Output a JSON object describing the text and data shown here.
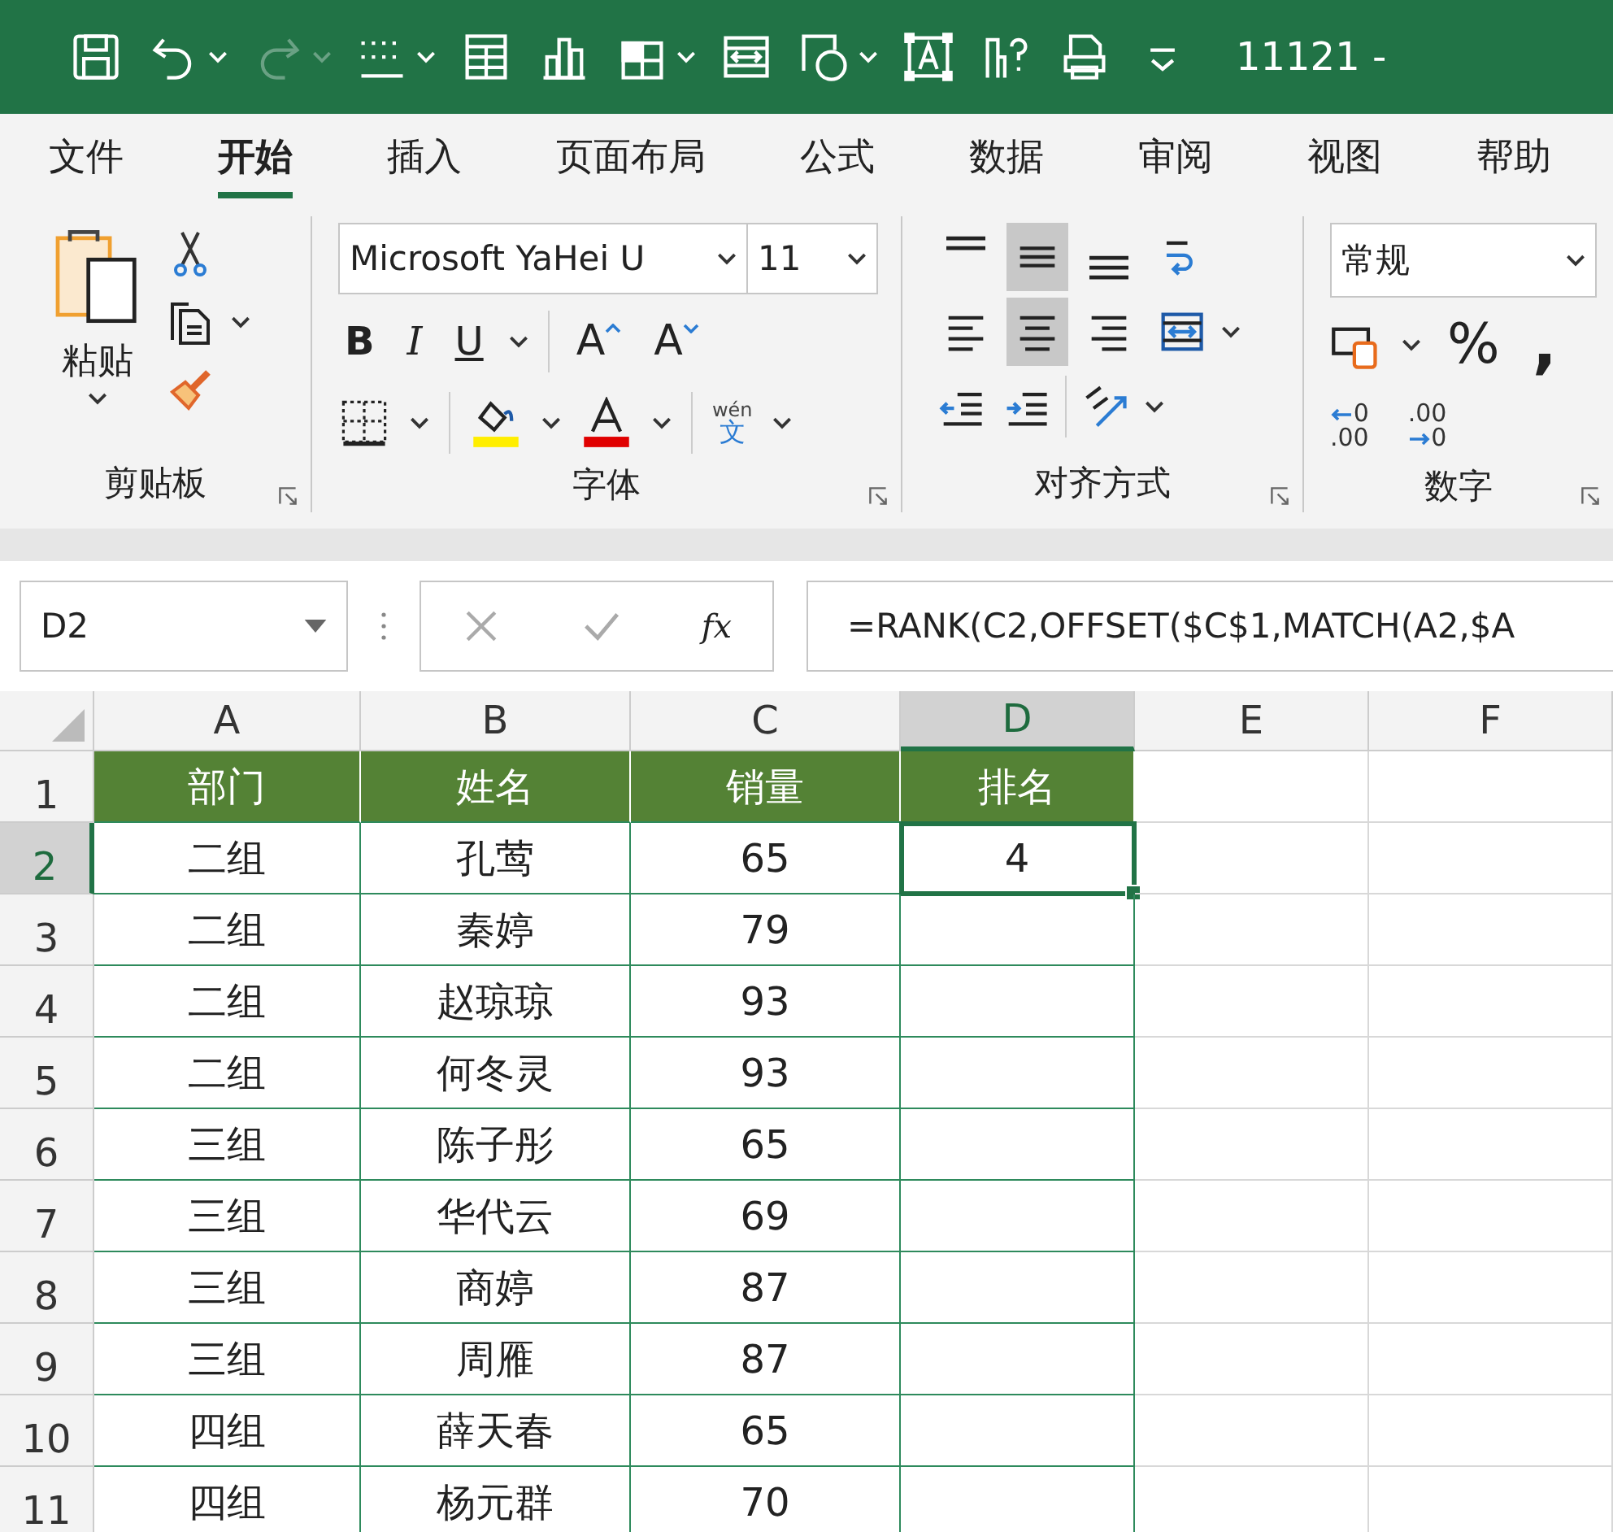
{
  "quick_access": [
    {
      "kind": "save",
      "dropdown": false,
      "disabled": false
    },
    {
      "kind": "undo",
      "dropdown": true,
      "disabled": false
    },
    {
      "kind": "redo",
      "dropdown": true,
      "disabled": true
    },
    {
      "kind": "border",
      "dropdown": true,
      "disabled": false
    },
    {
      "kind": "form",
      "dropdown": false,
      "disabled": false
    },
    {
      "kind": "chart",
      "dropdown": false,
      "disabled": false
    },
    {
      "kind": "grid",
      "dropdown": true,
      "disabled": false
    },
    {
      "kind": "merge",
      "dropdown": false,
      "disabled": false
    },
    {
      "kind": "shapes",
      "dropdown": true,
      "disabled": false
    },
    {
      "kind": "textbox",
      "dropdown": false,
      "disabled": false
    },
    {
      "kind": "whatif",
      "dropdown": false,
      "disabled": false
    },
    {
      "kind": "print",
      "dropdown": false,
      "disabled": false
    },
    {
      "kind": "customize",
      "dropdown": false,
      "disabled": false
    }
  ],
  "window": {
    "title": "11121 -"
  },
  "tabs": [
    {
      "label": "文件",
      "selected": false
    },
    {
      "label": "开始",
      "selected": true
    },
    {
      "label": "插入",
      "selected": false
    },
    {
      "label": "页面布局",
      "selected": false
    },
    {
      "label": "公式",
      "selected": false
    },
    {
      "label": "数据",
      "selected": false
    },
    {
      "label": "审阅",
      "selected": false
    },
    {
      "label": "视图",
      "selected": false
    },
    {
      "label": "帮助",
      "selected": false
    }
  ],
  "clipboard": {
    "paste_label": "粘贴",
    "group_label": "剪贴板"
  },
  "font": {
    "name": "Microsoft YaHei U",
    "size": "11",
    "styles": [
      "B",
      "I",
      "U"
    ],
    "grow": "A",
    "shrink": "A",
    "phonetic_top": "wén",
    "phonetic_bottom": "文",
    "group_label": "字体"
  },
  "alignment": {
    "buttons": [
      {
        "kind": "top",
        "selected": false
      },
      {
        "kind": "middle",
        "selected": true
      },
      {
        "kind": "bottom",
        "selected": false
      },
      {
        "kind": "wrap",
        "selected": false
      },
      {
        "kind": "left",
        "selected": false
      },
      {
        "kind": "center",
        "selected": true
      },
      {
        "kind": "right",
        "selected": false
      },
      {
        "kind": "merge",
        "selected": false
      }
    ],
    "group_label": "对齐方式"
  },
  "number": {
    "format": "常规",
    "percent": "%",
    "comma": ",",
    "decimals": [
      {
        "kind": "increase",
        "upper": "0",
        "lower": ".00"
      },
      {
        "kind": "decrease",
        "upper": ".00",
        "lower": "0"
      }
    ],
    "group_label": "数字"
  },
  "formula_bar": {
    "name_box": "D2",
    "fx": "fx",
    "formula": "=RANK(C2,OFFSET($C$1,MATCH(A2,$A"
  },
  "sheet": {
    "columns": [
      {
        "label": "A",
        "selected": false
      },
      {
        "label": "B",
        "selected": false
      },
      {
        "label": "C",
        "selected": false
      },
      {
        "label": "D",
        "selected": true
      },
      {
        "label": "E",
        "selected": false
      },
      {
        "label": "F",
        "selected": false
      }
    ],
    "rows": [
      {
        "number": "1",
        "kind": "header",
        "selected": false,
        "cells": [
          "部门",
          "姓名",
          "销量",
          "排名"
        ]
      },
      {
        "number": "2",
        "kind": "data",
        "selected": true,
        "cells": [
          "二组",
          "孔莺",
          "65",
          "4"
        ]
      },
      {
        "number": "3",
        "kind": "data",
        "selected": false,
        "cells": [
          "二组",
          "秦婷",
          "79"
        ]
      },
      {
        "number": "4",
        "kind": "data",
        "selected": false,
        "cells": [
          "二组",
          "赵琼琼",
          "93"
        ]
      },
      {
        "number": "5",
        "kind": "data",
        "selected": false,
        "cells": [
          "二组",
          "何冬灵",
          "93"
        ]
      },
      {
        "number": "6",
        "kind": "data",
        "selected": false,
        "cells": [
          "三组",
          "陈子彤",
          "65"
        ]
      },
      {
        "number": "7",
        "kind": "data",
        "selected": false,
        "cells": [
          "三组",
          "华代云",
          "69"
        ]
      },
      {
        "number": "8",
        "kind": "data",
        "selected": false,
        "cells": [
          "三组",
          "商婷",
          "87"
        ]
      },
      {
        "number": "9",
        "kind": "data",
        "selected": false,
        "cells": [
          "三组",
          "周雁",
          "87"
        ]
      },
      {
        "number": "10",
        "kind": "data",
        "selected": false,
        "cells": [
          "四组",
          "薛天春",
          "65"
        ]
      },
      {
        "number": "11",
        "kind": "data",
        "selected": false,
        "cells": [
          "四组",
          "杨元群",
          "70"
        ]
      }
    ]
  }
}
